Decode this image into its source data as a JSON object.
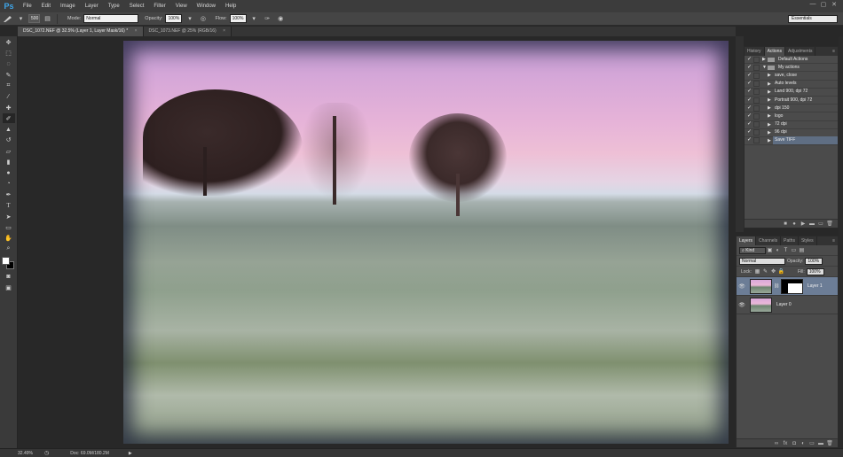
{
  "app": {
    "logo": "Ps"
  },
  "menu": [
    "File",
    "Edit",
    "Image",
    "Layer",
    "Type",
    "Select",
    "Filter",
    "View",
    "Window",
    "Help"
  ],
  "window_controls": [
    "—",
    "▢",
    "✕"
  ],
  "options": {
    "brush_size": "500",
    "mode_label": "Mode:",
    "mode_value": "Normal",
    "opacity_label": "Opacity:",
    "opacity_value": "100%",
    "flow_label": "Flow:",
    "flow_value": "100%",
    "workspace": "Essentials"
  },
  "tabs": [
    {
      "label": "DSC_1072.NEF @ 32.5% (Layer 1, Layer Mask/16) *",
      "close": "×"
    },
    {
      "label": "DSC_1073.NEF @ 25% (RGB/16)",
      "close": "×"
    }
  ],
  "tools": [
    "move",
    "marquee",
    "lasso",
    "quick-select",
    "crop",
    "eyedropper",
    "spot-heal",
    "brush",
    "stamp",
    "history-brush",
    "eraser",
    "gradient",
    "blur",
    "dodge",
    "pen",
    "type",
    "path-select",
    "shape",
    "hand",
    "zoom"
  ],
  "actions_panel": {
    "tabs": [
      "History",
      "Actions",
      "Adjustments"
    ],
    "menu": "≡",
    "items": [
      {
        "name": "Default Actions",
        "indent": 0,
        "type": "set",
        "collapsed": true
      },
      {
        "name": "My actions",
        "indent": 0,
        "type": "set",
        "collapsed": false
      },
      {
        "name": "save, close",
        "indent": 1
      },
      {
        "name": "Auto levels",
        "indent": 1
      },
      {
        "name": "Land 900, dpi 72",
        "indent": 1
      },
      {
        "name": "Portrait 900, dpi 72",
        "indent": 1
      },
      {
        "name": "dpi 150",
        "indent": 1
      },
      {
        "name": "logo",
        "indent": 1
      },
      {
        "name": "72 dpi",
        "indent": 1
      },
      {
        "name": "96 dpi",
        "indent": 1
      },
      {
        "name": "Save TIFF",
        "indent": 1,
        "selected": true
      }
    ],
    "footer_buttons": [
      "■",
      "●",
      "▶",
      "▬",
      "▭",
      "🗑"
    ]
  },
  "layers_panel": {
    "tabs": [
      "Layers",
      "Channels",
      "Paths",
      "Styles"
    ],
    "menu": "≡",
    "kind_label": "Kind",
    "blend_mode": "Normal",
    "opacity_label": "Opacity:",
    "opacity_value": "100%",
    "lock_label": "Lock:",
    "fill_label": "Fill:",
    "fill_value": "100%",
    "layers": [
      {
        "name": "Layer 1",
        "has_mask": true,
        "selected": true
      },
      {
        "name": "Layer 0",
        "has_mask": false,
        "selected": false
      }
    ],
    "footer_buttons": [
      "∞",
      "fx",
      "◘",
      "◐",
      "▭",
      "▬",
      "🗑"
    ]
  },
  "status": {
    "zoom": "32.49%",
    "doc": "Doc: 69.0M/180.2M",
    "arrow": "▶"
  }
}
